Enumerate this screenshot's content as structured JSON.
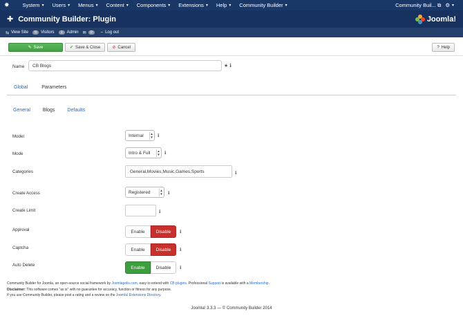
{
  "navbar": {
    "items": [
      {
        "label": "System"
      },
      {
        "label": "Users"
      },
      {
        "label": "Menus"
      },
      {
        "label": "Content"
      },
      {
        "label": "Components"
      },
      {
        "label": "Extensions"
      },
      {
        "label": "Help"
      },
      {
        "label": "Community Builder"
      }
    ],
    "site_label": "Community Buil...",
    "external_glyph": "⧉",
    "settings_glyph": "⚙"
  },
  "header": {
    "title": "Community Builder: Plugin",
    "brand": "Joomla!"
  },
  "status": {
    "view_site": "View Site",
    "visitors_count": "0",
    "visitors_label": "Visitors",
    "admin_count": "1",
    "admin_label": "Admin",
    "messages_count": "0",
    "logout_label": "Log out"
  },
  "toolbar": {
    "save": "Save",
    "save_close": "Save & Close",
    "cancel": "Cancel",
    "help": "Help"
  },
  "plugin": {
    "name_label": "Name",
    "name_value": "CB Blogs"
  },
  "tabs": {
    "global": "Global",
    "parameters": "Parameters"
  },
  "subtabs": {
    "general": "General",
    "blogs": "Blogs",
    "defaults": "Defaults"
  },
  "form": {
    "model": {
      "label": "Model",
      "value": "Internal"
    },
    "mode": {
      "label": "Mode",
      "value": "Intro & Full"
    },
    "categories": {
      "label": "Categories",
      "value": "General,Movies,Music,Games,Sports"
    },
    "create_access": {
      "label": "Create Access",
      "value": "Registered"
    },
    "create_limit": {
      "label": "Create Limit",
      "value": ""
    },
    "approval": {
      "label": "Approval",
      "enable": "Enable",
      "disable": "Disable",
      "selected": "Disable"
    },
    "captcha": {
      "label": "Captcha",
      "enable": "Enable",
      "disable": "Disable",
      "selected": "Disable"
    },
    "auto_delete": {
      "label": "Auto Delete",
      "enable": "Enable",
      "disable": "Disable",
      "selected": "Enable"
    }
  },
  "footer": {
    "line1_a": "Community Builder for Joomla, an open-source social framework by ",
    "line1_link1": "Joomlapolis.com",
    "line1_b": ", easy to extend with ",
    "line1_link2": "CB plugins",
    "line1_c": ". Professional ",
    "line1_link3": "Support",
    "line1_d": " is available with a ",
    "line1_link4": "Membership",
    "line1_e": ".",
    "line2_bold": "Disclaimer:",
    "line2_text": " This software comes \"as is\" with no guarantee for accuracy, function or fitness for any purpose.",
    "line3_text": "If you use Community Builder, please post a rating and a review on the ",
    "line3_link": "Joomla! Extensions Directory",
    "line3_end": ".",
    "copyright": "Joomla! 3.3.3  —  © Community Builder 2014"
  },
  "colors": {
    "navbar_bg": "#1a3867",
    "save_green": "#46a046",
    "disable_red": "#c9302c",
    "link_blue": "#2a6ab8"
  }
}
